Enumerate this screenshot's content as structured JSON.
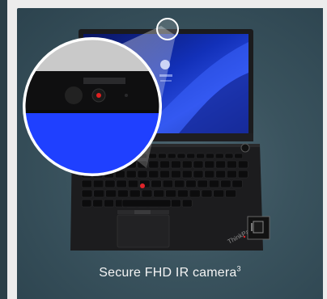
{
  "feature": {
    "caption": "Secure FHD IR camera",
    "footnote": "3"
  },
  "device": {
    "logo_text": "ThinkPad"
  },
  "colors": {
    "card_background": "#3a535e",
    "screen_accent": "#1f40ff",
    "trackpoint": "#e0242a",
    "left_strip": "#2b3f48"
  },
  "icons": {
    "camera_lens": "camera-icon",
    "ir_sensor": "ir-sensor-icon",
    "laptop": "laptop-illustration"
  }
}
